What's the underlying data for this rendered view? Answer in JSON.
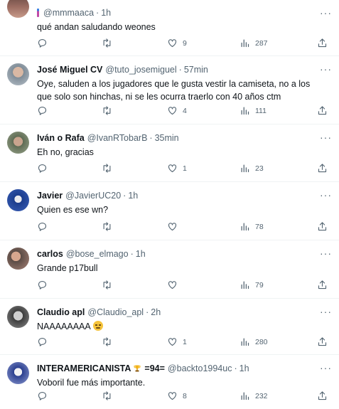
{
  "replies": [
    {
      "name": "",
      "handle": "@mmmaaca",
      "time": "1h",
      "text": "qué andan saludando weones",
      "likes": "9",
      "views": "287",
      "replies": "",
      "retweets": ""
    },
    {
      "name": "José Miguel CV",
      "handle": "@tuto_josemiguel",
      "time": "57min",
      "text": "Oye, saluden a los jugadores que le gusta vestir la camiseta, no a los que solo son hinchas, ni se les ocurra traerlo con 40 años ctm",
      "likes": "4",
      "views": "111",
      "replies": "",
      "retweets": ""
    },
    {
      "name": "Iván o Rafa",
      "handle": "@IvanRTobarB",
      "time": "35min",
      "text": "Eh no, gracias",
      "likes": "1",
      "views": "23",
      "replies": "",
      "retweets": ""
    },
    {
      "name": "Javier",
      "handle": "@JavierUC20",
      "time": "1h",
      "text": "Quien es ese wn?",
      "likes": "",
      "views": "78",
      "replies": "",
      "retweets": ""
    },
    {
      "name": "carlos",
      "handle": "@bose_elmago",
      "time": "1h",
      "text": "Grande p17bull",
      "likes": "",
      "views": "79",
      "replies": "",
      "retweets": ""
    },
    {
      "name": "Claudio apl",
      "handle": "@Claudio_apl",
      "time": "2h",
      "text": "NAAAAAAAA",
      "likes": "1",
      "views": "280",
      "replies": "",
      "retweets": ""
    },
    {
      "name": "INTERAMERICANISTA",
      "name_suffix": "=94=",
      "handle": "@backto1994uc",
      "time": "1h",
      "text": "Voboril fue más importante.",
      "likes": "8",
      "views": "232",
      "replies": "",
      "retweets": ""
    }
  ],
  "icons": {
    "reply": "reply-icon",
    "retweet": "retweet-icon",
    "like": "heart-icon",
    "views": "views-icon",
    "share": "share-icon",
    "more": "more-options-icon",
    "emoji": "unamused-face-emoji",
    "trophy": "trophy-icon"
  },
  "colors": {
    "text": "#0f1419",
    "secondary": "#536471",
    "divider": "#eff3f4"
  }
}
